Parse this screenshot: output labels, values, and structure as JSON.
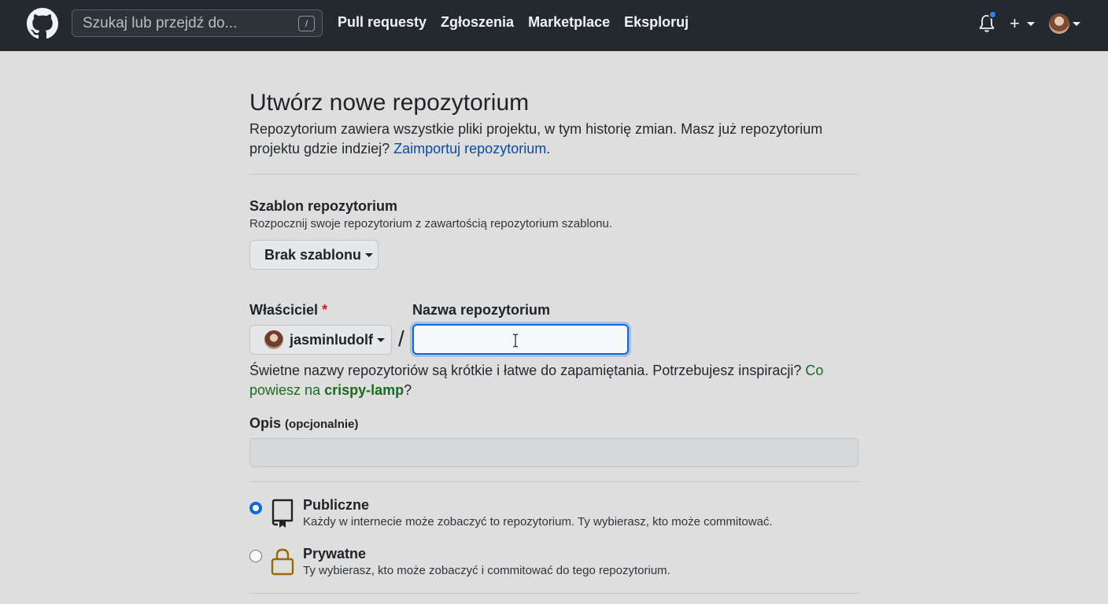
{
  "header": {
    "search_placeholder": "Szukaj lub przejdź do...",
    "search_shortcut": "/",
    "nav": [
      "Pull requesty",
      "Zgłoszenia",
      "Marketplace",
      "Eksploruj"
    ],
    "new_label": "+",
    "notification_dot_color": "#2f81f7"
  },
  "page": {
    "title": "Utwórz nowe repozytorium",
    "intro_text": "Repozytorium zawiera wszystkie pliki projektu, w tym historię zmian. Masz już repozytorium projektu gdzie indziej?",
    "import_link": "Zaimportuj repozytorium",
    "intro_end": "."
  },
  "template": {
    "label": "Szablon repozytorium",
    "description": "Rozpocznij swoje repozytorium z zawartością repozytorium szablonu.",
    "button": "Brak szablonu"
  },
  "owner": {
    "label": "Właściciel",
    "required_mark": "*",
    "value": "jasminludolf"
  },
  "repo_name": {
    "label": "Nazwa repozytorium",
    "separator": "/",
    "value": ""
  },
  "hint": {
    "text": "Świetne nazwy repozytoriów są krótkie i łatwe do zapamiętania. Potrzebujesz inspiracji?",
    "suggest_prefix": "Co powiesz na",
    "suggestion": "crispy-lamp",
    "suffix": "?"
  },
  "description": {
    "label": "Opis",
    "optional": "(opcjonalnie)",
    "value": ""
  },
  "visibility": {
    "public": {
      "title": "Publiczne",
      "description": "Każdy w internecie może zobaczyć to repozytorium. Ty wybierasz, kto może commitować.",
      "checked": true
    },
    "private": {
      "title": "Prywatne",
      "description": "Ty wybierasz, kto może zobaczyć i commitować do tego repozytorium.",
      "checked": false
    }
  },
  "colors": {
    "header_bg": "#24292f",
    "link": "#0b4aa2",
    "suggestion": "#1a6b1f",
    "focus": "#0969da",
    "required": "#cf222e",
    "lock_icon": "#9a6700"
  }
}
